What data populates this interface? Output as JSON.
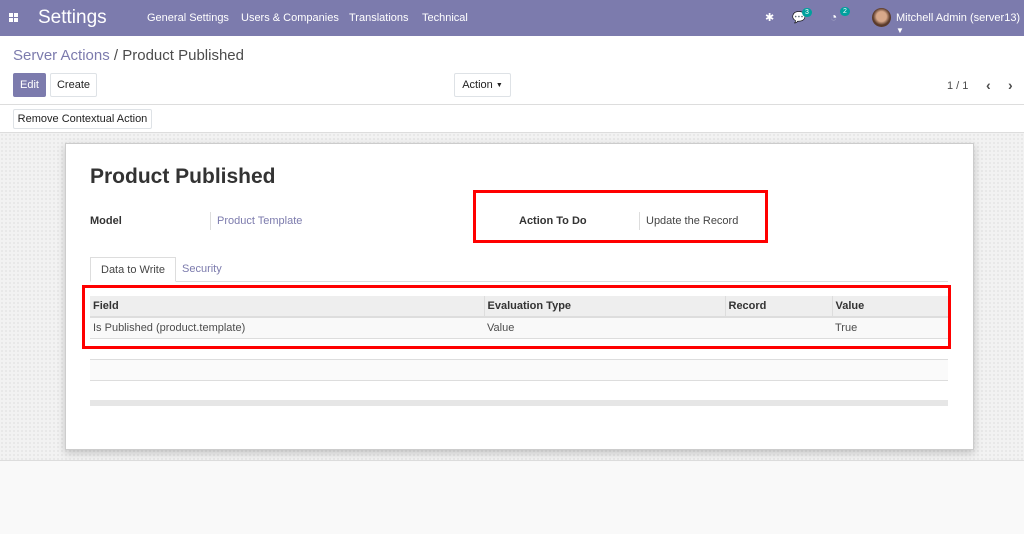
{
  "navbar": {
    "brand": "Settings",
    "menus": [
      "General Settings",
      "Users & Companies",
      "Translations",
      "Technical"
    ],
    "messages_count": "3",
    "activities_count": "2",
    "user": "Mitchell Admin (server13)"
  },
  "breadcrumb": {
    "parent": "Server Actions",
    "separator": "/",
    "current": "Product Published"
  },
  "toolbar": {
    "edit": "Edit",
    "create": "Create",
    "action": "Action",
    "pager": "1 / 1",
    "remove_contextual": "Remove Contextual Action"
  },
  "form": {
    "title": "Product Published",
    "model_label": "Model",
    "model_value": "Product Template",
    "action_label": "Action To Do",
    "action_value": "Update the Record"
  },
  "tabs": [
    "Data to Write",
    "Security"
  ],
  "table": {
    "headers": [
      "Field",
      "Evaluation Type",
      "Record",
      "Value"
    ],
    "rows": [
      [
        "Is Published (product.template)",
        "Value",
        "",
        "True"
      ]
    ]
  }
}
